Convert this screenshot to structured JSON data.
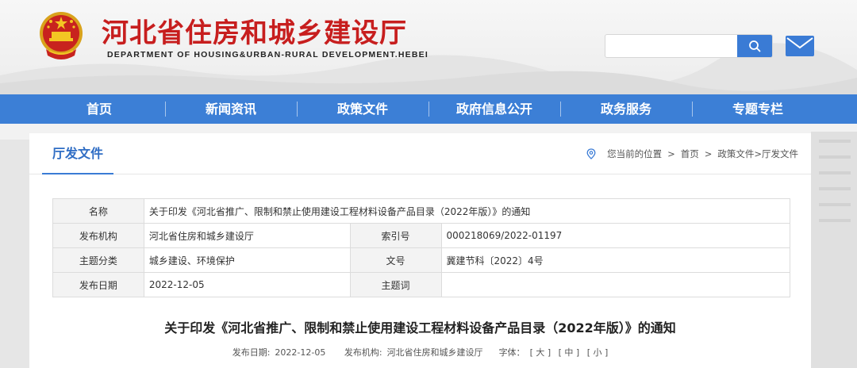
{
  "site": {
    "title": "河北省住房和城乡建设厅",
    "subtitle": "DEPARTMENT OF HOUSING&URBAN-RURAL DEVELOPMENT.HEBEI",
    "search_placeholder": ""
  },
  "nav": [
    {
      "label": "首页"
    },
    {
      "label": "新闻资讯"
    },
    {
      "label": "政策文件"
    },
    {
      "label": "政府信息公开"
    },
    {
      "label": "政务服务"
    },
    {
      "label": "专题专栏"
    }
  ],
  "panel": {
    "title": "厅发文件",
    "breadcrumb": {
      "prefix": "您当前的位置",
      "home": "首页",
      "path": "政策文件>厅发文件"
    }
  },
  "info": {
    "name_label": "名称",
    "name_value": "关于印发《河北省推广、限制和禁止使用建设工程材料设备产品目录（2022年版）》的通知",
    "org_label": "发布机构",
    "org_value": "河北省住房和城乡建设厅",
    "index_label": "索引号",
    "index_value": "000218069/2022-01197",
    "topic_label": "主题分类",
    "topic_value": "城乡建设、环境保护",
    "doc_label": "文号",
    "doc_value": "冀建节科〔2022〕4号",
    "date_label": "发布日期",
    "date_value": "2022-12-05",
    "keyword_label": "主题词",
    "keyword_value": ""
  },
  "article": {
    "title": "关于印发《河北省推广、限制和禁止使用建设工程材料设备产品目录（2022年版）》的通知",
    "date_label": "发布日期:",
    "date": "2022-12-05",
    "org_label": "发布机构:",
    "org": "河北省住房和城乡建设厅",
    "fontsize_label": "字体：",
    "font_large": "[ 大 ]",
    "font_medium": "[ 中 ]",
    "font_small": "[ 小 ]"
  },
  "colors": {
    "brand_red": "#c71e1e",
    "nav_blue": "#3c7fd6",
    "accent_blue": "#3a7bd5"
  },
  "icons": [
    "national-emblem-icon",
    "search-icon",
    "mail-icon",
    "location-pin-icon"
  ]
}
